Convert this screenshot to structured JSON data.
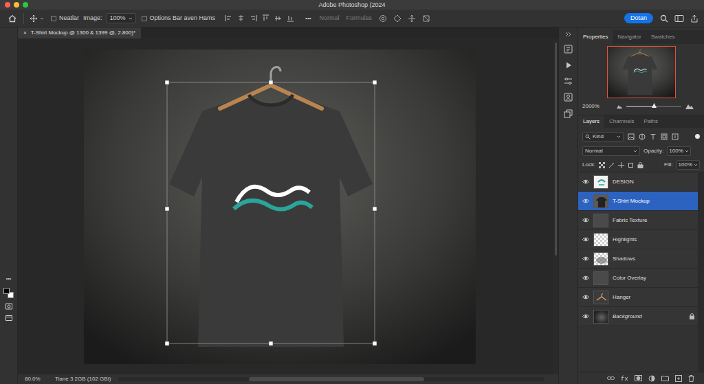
{
  "window": {
    "title": "Adobe Photoshop (2024"
  },
  "options_bar": {
    "auto_select": {
      "label": "Neatlar",
      "checked": false
    },
    "image_label": "Image:",
    "zoom": "100%",
    "options_check": {
      "label": "Options Bar aven Hams",
      "checked": false
    },
    "more": "•••",
    "blend": {
      "label": "Normal",
      "disabled": true
    },
    "formulas": {
      "label": "Formulas",
      "disabled": true
    },
    "user_button": "Dotan"
  },
  "document_tab": {
    "close": "×",
    "title": "T-Shirt Mockup @ 1300 & 1399 @, 2.800)*"
  },
  "toolbar": {
    "more": "•••"
  },
  "panel_tabs": [
    {
      "label": "Properties",
      "selected": true
    },
    {
      "label": "Navigator",
      "selected": false
    },
    {
      "label": "Swatches",
      "selected": false
    }
  ],
  "navigator": {
    "zoom": "2000%",
    "level": 0.5
  },
  "layers_panel": {
    "tabs": [
      {
        "label": "Layers",
        "selected": true
      },
      {
        "label": "Charnnels",
        "selected": false
      },
      {
        "label": "Paths",
        "selected": false
      }
    ],
    "filter": "Kind",
    "blend_mode": "Normal",
    "opacity_label": "Opacity:",
    "opacity": "100%",
    "lock_label": "Lock:",
    "fill_label": "Fill:",
    "fill": "100%"
  },
  "layers": [
    {
      "name": "DESIGN",
      "visible": true,
      "selected": false,
      "locked": false,
      "kind": "design"
    },
    {
      "name": "T-Shirt Mockup",
      "visible": true,
      "selected": true,
      "locked": false,
      "kind": "shirt"
    },
    {
      "name": "Fabric Texture",
      "visible": true,
      "selected": false,
      "locked": false,
      "kind": "solid"
    },
    {
      "name": "Highlights",
      "visible": true,
      "selected": false,
      "locked": false,
      "kind": "checker"
    },
    {
      "name": "Shadows",
      "visible": true,
      "selected": false,
      "locked": false,
      "kind": "shadow"
    },
    {
      "name": "Color Overlay",
      "visible": true,
      "selected": false,
      "locked": false,
      "kind": "solid"
    },
    {
      "name": "Hanger",
      "visible": true,
      "selected": false,
      "locked": false,
      "kind": "hanger"
    },
    {
      "name": "Background",
      "visible": true,
      "selected": false,
      "locked": true,
      "kind": "background"
    }
  ],
  "status_bar": {
    "zoom": "80.0%",
    "info": "Tiane 3 2GB (102 GBI)"
  }
}
